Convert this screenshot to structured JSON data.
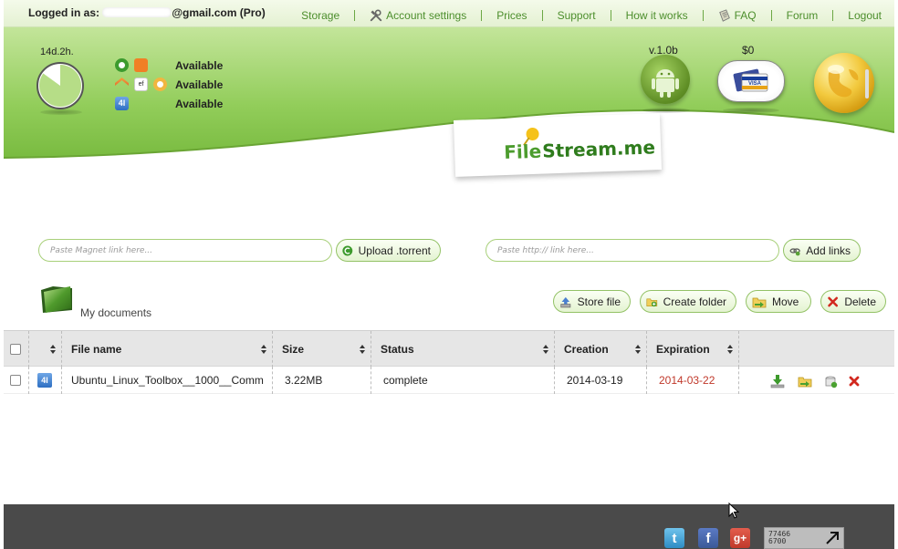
{
  "user": {
    "logged_in_prefix": "Logged in as:",
    "email_suffix": "@gmail.com (Pro)"
  },
  "nav": [
    {
      "label": "Storage",
      "icon": null
    },
    {
      "label": "Account settings",
      "icon": "wrench-icon"
    },
    {
      "label": "Prices",
      "icon": null
    },
    {
      "label": "Support",
      "icon": null
    },
    {
      "label": "How it works",
      "icon": null
    },
    {
      "label": "FAQ",
      "icon": "faq-icon"
    },
    {
      "label": "Forum",
      "icon": null
    },
    {
      "label": "Logout",
      "icon": null
    }
  ],
  "quota": {
    "label": "14d.2h.",
    "fraction_remaining": 0.85
  },
  "services": [
    {
      "icons": [
        "filestream-icon",
        "share-icon"
      ],
      "status": "Available"
    },
    {
      "icons": [
        "chevrons-icon",
        "ef-icon",
        "bubble-icon"
      ],
      "status": "Available"
    },
    {
      "icons": [
        "4l-icon"
      ],
      "status": "Available"
    }
  ],
  "header": {
    "version_label": "v.1.0b",
    "balance_label": "$0"
  },
  "logo": {
    "text_a": "File",
    "text_b": "Stream.me"
  },
  "upload": {
    "magnet_placeholder": "Paste Magnet link here...",
    "upload_label": "Upload .torrent",
    "http_placeholder": "Paste http:// link here...",
    "addlinks_label": "Add links"
  },
  "folder": {
    "label": "My documents"
  },
  "toolbar": {
    "store_label": "Store file",
    "create_label": "Create folder",
    "move_label": "Move",
    "delete_label": "Delete"
  },
  "table": {
    "columns": [
      "File name",
      "Size",
      "Status",
      "Creation",
      "Expiration"
    ],
    "rows": [
      {
        "filename": "Ubuntu_Linux_Toolbox__1000__Comm",
        "size": "3.22MB",
        "status": "complete",
        "creation": "2014-03-19",
        "expiration": "2014-03-22"
      }
    ]
  },
  "footer": {
    "counter_line1": "77466",
    "counter_line2": "6700"
  },
  "colors": {
    "green_dark": "#4c8e2c",
    "green_header": "#8cc955",
    "expiration_red": "#c0392b",
    "footer_bg": "#4a4a4a"
  }
}
